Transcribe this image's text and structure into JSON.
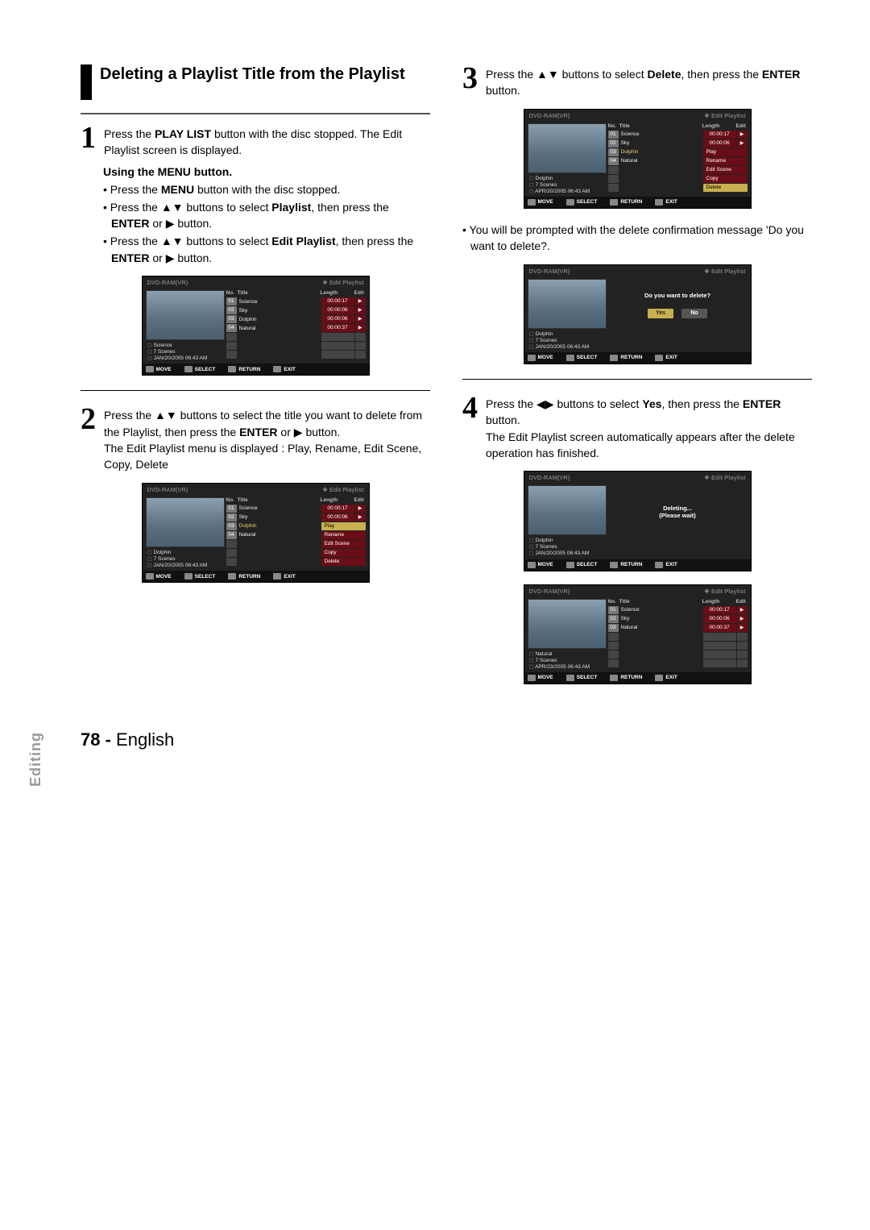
{
  "heading": "Deleting a Playlist Title from the Playlist",
  "steps": {
    "s1": "Press the PLAY LIST button with the disc stopped. The Edit Playlist screen is displayed.",
    "s2": "Press the ▲▼ buttons to select the title you want to delete from the Playlist, then press the ENTER or ▶ button.\nThe Edit Playlist menu is displayed : Play, Rename, Edit Scene, Copy, Delete",
    "s3": "Press the ▲▼ buttons to select Delete, then press the ENTER button.",
    "s4": "Press the ◀▶ buttons to select Yes, then press the ENTER button.\nThe Edit Playlist screen automatically appears after the delete operation has finished."
  },
  "sub_heading": "Using the MENU button.",
  "bullets": [
    "Press the MENU button with the disc stopped.",
    "Press the ▲▼ buttons to select Playlist, then press the ENTER or ▶ button.",
    "Press the ▲▼ buttons to select Edit Playlist, then press the ENTER or ▶ button."
  ],
  "note_after_s3": "You will be prompted with the delete confirmation message 'Do you want to delete?.",
  "screen_common": {
    "disc": "DVD-RAM(VR)",
    "mode": "❖ Edit Playlist",
    "col_no": "No.",
    "col_title": "Title",
    "col_len": "Length",
    "col_edit": "Edit",
    "move": "MOVE",
    "select": "SELECT",
    "return": "RETURN",
    "exit": "EXIT"
  },
  "screen1": {
    "rows": [
      {
        "no": "01",
        "title": "Science",
        "len": "00:00:17"
      },
      {
        "no": "02",
        "title": "Sky",
        "len": "00:00:06"
      },
      {
        "no": "03",
        "title": "Dolphin",
        "len": "00:00:06"
      },
      {
        "no": "04",
        "title": "Natural",
        "len": "00:00:37"
      }
    ],
    "meta_title": "Science",
    "meta_scenes": "7 Scenes",
    "meta_date": "JAN/20/2005 06:43 AM"
  },
  "screen2": {
    "rows": [
      {
        "no": "01",
        "title": "Science",
        "len": "00:00:17"
      },
      {
        "no": "02",
        "title": "Sky",
        "len": "00:00:06"
      },
      {
        "no": "03",
        "title": "Dolphin"
      },
      {
        "no": "04",
        "title": "Natural"
      }
    ],
    "menu": [
      "Play",
      "Rename",
      "Edit Scene",
      "Copy",
      "Delete"
    ],
    "meta_title": "Dolphin",
    "meta_scenes": "7 Scenes",
    "meta_date": "JAN/20/2005 06:43 AM"
  },
  "screen3": {
    "rows": [
      {
        "no": "01",
        "title": "Science",
        "len": "00:00:17"
      },
      {
        "no": "02",
        "title": "Sky",
        "len": "00:00:06"
      },
      {
        "no": "03",
        "title": "Dolphin"
      },
      {
        "no": "04",
        "title": "Natural"
      }
    ],
    "menu": [
      "Play",
      "Rename",
      "Edit Scene",
      "Copy",
      "Delete"
    ],
    "meta_title": "Dolphin",
    "meta_scenes": "7 Scenes",
    "meta_date": "APR/20/2005 06:43 AM"
  },
  "confirm": {
    "msg": "Do you want to delete?",
    "yes": "Yes",
    "no": "No",
    "meta_title": "Dolphin",
    "meta_scenes": "7 Scenes",
    "meta_date": "JAN/20/2005 06:43 AM"
  },
  "deleting": {
    "msg1": "Deleting...",
    "msg2": "(Please wait)",
    "meta_title": "Dolphin",
    "meta_scenes": "7 Scenes",
    "meta_date": "JAN/20/2005 06:43 AM"
  },
  "screen6": {
    "rows": [
      {
        "no": "01",
        "title": "Science",
        "len": "00:00:17"
      },
      {
        "no": "02",
        "title": "Sky",
        "len": "00:00:06"
      },
      {
        "no": "03",
        "title": "Natural",
        "len": "00:00:37"
      }
    ],
    "meta_title": "Natural",
    "meta_scenes": "7 Scenes",
    "meta_date": "APR/23/2005 06:43 AM"
  },
  "side_tab": "Editing",
  "page_number": "78 -",
  "page_lang": "English"
}
